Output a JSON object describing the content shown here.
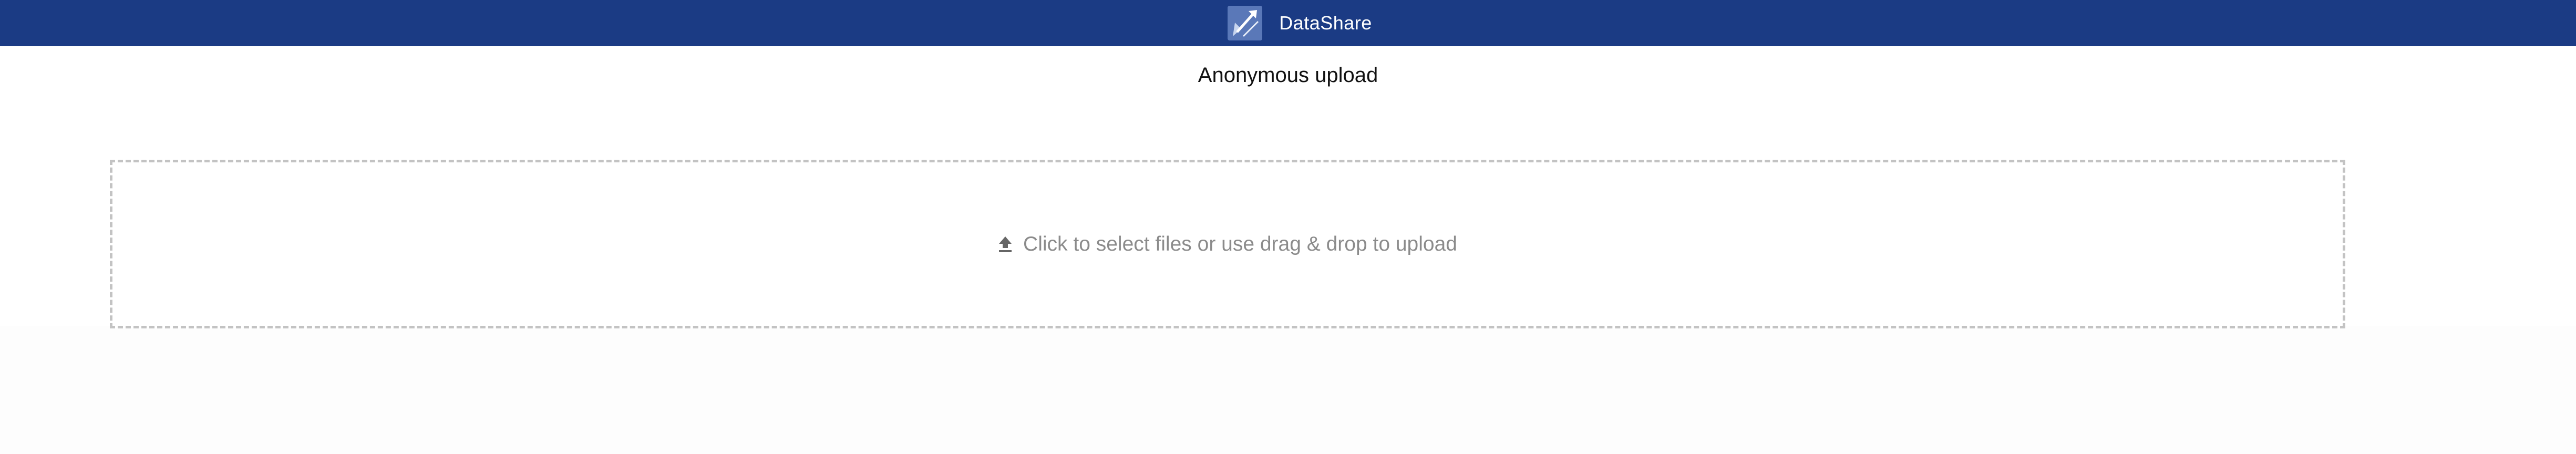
{
  "header": {
    "brand": "DataShare",
    "logo_icon": "datashare-logo-icon",
    "background_color": "#1b3b84"
  },
  "page": {
    "title": "Anonymous upload"
  },
  "dropzone": {
    "icon": "upload-icon",
    "label": "Click to select files or use drag & drop to upload"
  }
}
